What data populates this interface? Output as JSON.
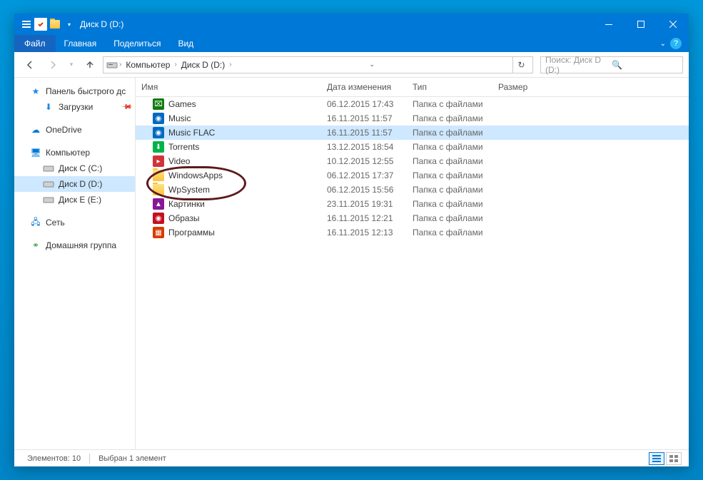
{
  "titlebar": {
    "title": "Диск D (D:)"
  },
  "menubar": {
    "file": "Файл",
    "tabs": [
      "Главная",
      "Поделиться",
      "Вид"
    ]
  },
  "breadcrumb": {
    "items": [
      "Компьютер",
      "Диск D (D:)"
    ]
  },
  "search": {
    "placeholder": "Поиск: Диск D (D:)"
  },
  "nav": {
    "quick": {
      "label": "Панель быстрого дс",
      "star": "★"
    },
    "downloads": "Загрузки",
    "onedrive": "OneDrive",
    "computer": "Компьютер",
    "drives": [
      {
        "label": "Диск C (C:)"
      },
      {
        "label": "Диск D (D:)"
      },
      {
        "label": "Диск E (E:)"
      }
    ],
    "network": "Сеть",
    "homegroup": "Домашняя группа"
  },
  "columns": {
    "name": "Имя",
    "date": "Дата изменения",
    "type": "Тип",
    "size": "Размер"
  },
  "files": [
    {
      "icon": "xbox",
      "name": "Games",
      "date": "06.12.2015 17:43",
      "type": "Папка с файлами",
      "size": ""
    },
    {
      "icon": "music",
      "name": "Music",
      "date": "16.11.2015 11:57",
      "type": "Папка с файлами",
      "size": ""
    },
    {
      "icon": "music",
      "name": "Music FLAC",
      "date": "16.11.2015 11:57",
      "type": "Папка с файлами",
      "size": "",
      "selected": true
    },
    {
      "icon": "torrent",
      "name": "Torrents",
      "date": "13.12.2015 18:54",
      "type": "Папка с файлами",
      "size": ""
    },
    {
      "icon": "video",
      "name": "Video",
      "date": "10.12.2015 12:55",
      "type": "Папка с файлами",
      "size": ""
    },
    {
      "icon": "folder",
      "name": "WindowsApps",
      "date": "06.12.2015 17:37",
      "type": "Папка с файлами",
      "size": ""
    },
    {
      "icon": "folder",
      "name": "WpSystem",
      "date": "06.12.2015 15:56",
      "type": "Папка с файлами",
      "size": ""
    },
    {
      "icon": "pictures",
      "name": "Картинки",
      "date": "23.11.2015 19:31",
      "type": "Папка с файлами",
      "size": ""
    },
    {
      "icon": "iso",
      "name": "Образы",
      "date": "16.11.2015 12:21",
      "type": "Папка с файлами",
      "size": ""
    },
    {
      "icon": "programs",
      "name": "Программы",
      "date": "16.11.2015 12:13",
      "type": "Папка с файлами",
      "size": ""
    }
  ],
  "status": {
    "count": "Элементов: 10",
    "selection": "Выбран 1 элемент"
  },
  "icon_colors": {
    "xbox": "#107c10",
    "music": "#006ac1",
    "torrent": "#00b34a",
    "video": "#d13438",
    "pictures": "#881798",
    "iso": "#c50f1f",
    "programs": "#d83b01"
  }
}
